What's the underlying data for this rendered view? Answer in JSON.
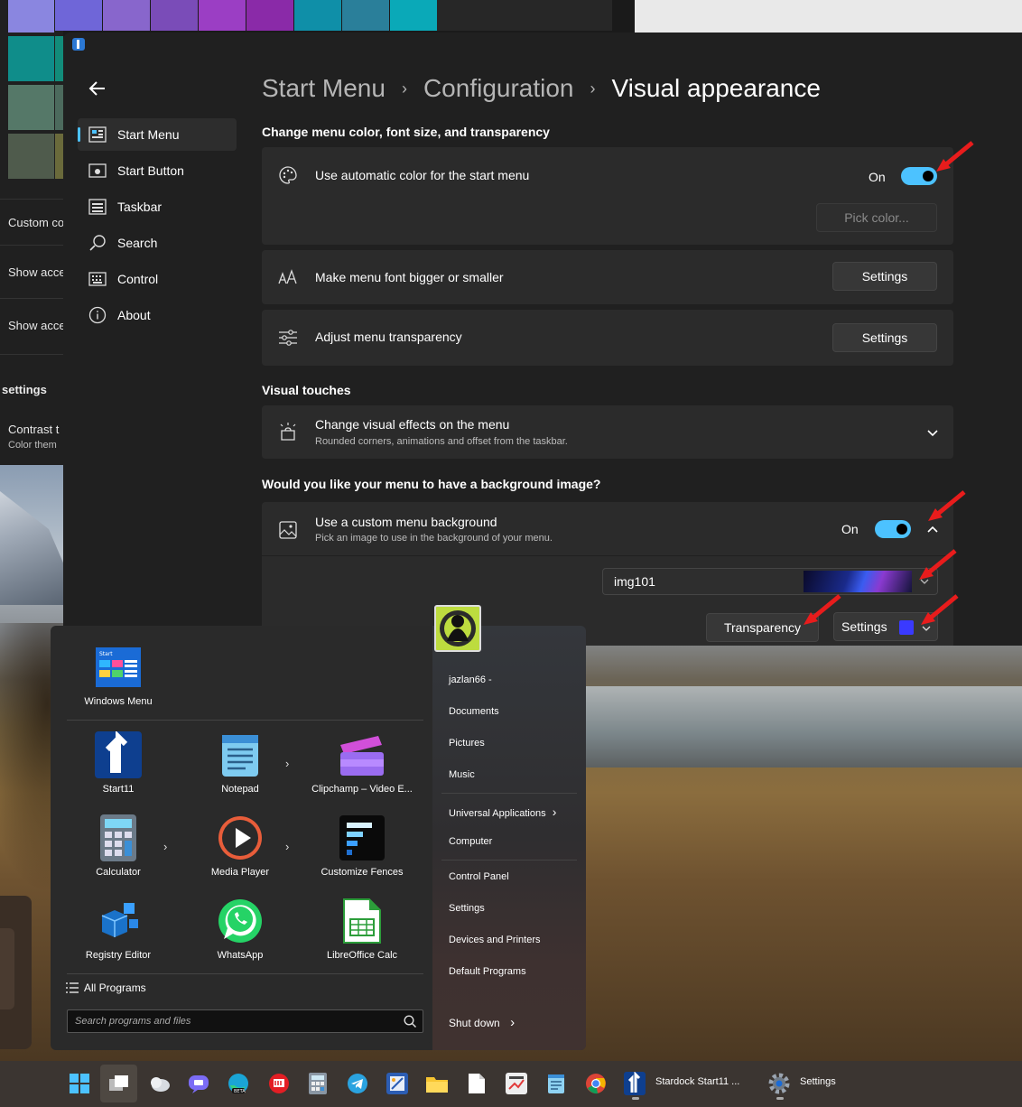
{
  "background": {
    "settings_items": [
      {
        "label": "Custom co"
      },
      {
        "label": "Show acce"
      },
      {
        "label": "Show acce"
      },
      {
        "label": "settings"
      },
      {
        "label": "Contrast t",
        "sub": "Color them"
      }
    ]
  },
  "window": {
    "nav": [
      {
        "label": "Start Menu",
        "icon": "start-menu-icon"
      },
      {
        "label": "Start Button",
        "icon": "start-button-icon"
      },
      {
        "label": "Taskbar",
        "icon": "taskbar-icon"
      },
      {
        "label": "Search",
        "icon": "search-icon"
      },
      {
        "label": "Control",
        "icon": "keyboard-icon"
      },
      {
        "label": "About",
        "icon": "info-icon"
      }
    ],
    "breadcrumb": [
      "Start Menu",
      "Configuration",
      "Visual appearance"
    ],
    "section1": {
      "title": "Change menu color, font size, and transparency",
      "auto_color": {
        "title": "Use automatic color for the start menu",
        "toggle_label": "On",
        "button": "Pick color..."
      },
      "font_size": {
        "title": "Make menu font bigger or smaller",
        "button": "Settings"
      },
      "transparency": {
        "title": "Adjust menu transparency",
        "button": "Settings"
      }
    },
    "section2": {
      "title": "Visual touches",
      "effects": {
        "title": "Change visual effects on the menu",
        "sub": "Rounded corners, animations and offset from the taskbar."
      }
    },
    "section3": {
      "title": "Would you like your menu to have a background image?",
      "background": {
        "title": "Use a custom menu background",
        "sub": "Pick an image to use in the background of your menu.",
        "toggle_label": "On"
      },
      "image_select": "img101",
      "transparency_button": "Transparency",
      "settings_button": "Settings"
    }
  },
  "start_menu": {
    "top_tile": "Windows Menu",
    "pinned": [
      "Start11",
      "Notepad",
      "Clipchamp – Video E...",
      "Calculator",
      "Media Player",
      "Customize Fences",
      "Registry Editor",
      "WhatsApp",
      "LibreOffice Calc"
    ],
    "all_programs": "All Programs",
    "search_placeholder": "Search programs and files",
    "user": "jazlan66 -",
    "links_1": [
      "Documents",
      "Pictures",
      "Music"
    ],
    "universal": "Universal Applications",
    "computer": "Computer",
    "links_2": [
      "Control Panel",
      "Settings",
      "Devices and Printers",
      "Default Programs"
    ],
    "shutdown": "Shut down"
  },
  "taskbar": {
    "start11_label": "Stardock Start11 ...",
    "settings_label": "Settings"
  },
  "colors": {
    "accent": "#4cc2ff",
    "arrow": "#e81c1c",
    "swatch_blue": "#3a3aff"
  }
}
